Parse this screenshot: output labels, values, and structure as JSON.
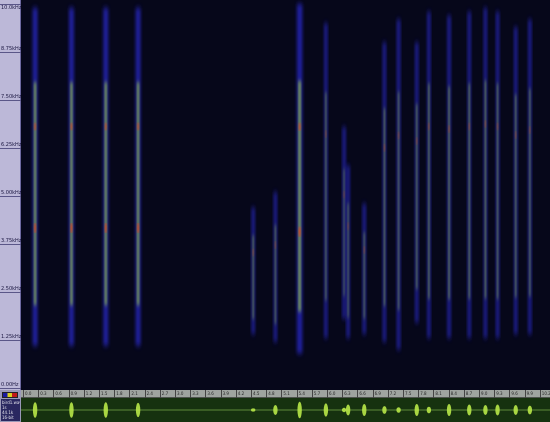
{
  "freq_ruler": {
    "labels": [
      "10.0kHz",
      "8.75kHz",
      "7.50kHz",
      "6.25kHz",
      "5.00kHz",
      "3.75kHz",
      "2.50kHz",
      "1.25kHz",
      "0.00Hz"
    ]
  },
  "time_ruler": {
    "labels": [
      "0.0",
      "0.3",
      "0.6",
      "0.9",
      "1.2",
      "1.5",
      "1.8",
      "2.1",
      "2.4",
      "2.7",
      "3.0",
      "3.3",
      "3.6",
      "3.9",
      "4.2",
      "4.5",
      "4.8",
      "5.1",
      "5.4",
      "5.7",
      "6.0",
      "6.3",
      "6.6",
      "6.9",
      "7.2",
      "7.5",
      "7.8",
      "8.1",
      "8.4",
      "8.7",
      "9.0",
      "9.3",
      "9.6",
      "9.9",
      "10.2"
    ]
  },
  "info_panel": {
    "filename": "bird1.wav",
    "lines": [
      "1s",
      "44.1k",
      "16-bit"
    ]
  },
  "colors": {
    "background": "#06071a",
    "low": "#2a2ad0",
    "mid": "#a8e030",
    "high": "#ff2a10",
    "waveform": "#b8e848"
  },
  "spectrogram": {
    "calls": [
      {
        "t": 0.25,
        "w": 0.009,
        "f_lo": 1.1,
        "f_hi": 9.9,
        "i": 0.85
      },
      {
        "t": 1.15,
        "w": 0.009,
        "f_lo": 1.1,
        "f_hi": 9.9,
        "i": 0.85
      },
      {
        "t": 2.0,
        "w": 0.009,
        "f_lo": 1.1,
        "f_hi": 9.9,
        "i": 0.85
      },
      {
        "t": 2.8,
        "w": 0.009,
        "f_lo": 1.1,
        "f_hi": 9.9,
        "i": 0.85
      },
      {
        "t": 5.65,
        "w": 0.004,
        "f_lo": 1.4,
        "f_hi": 4.7,
        "i": 0.6
      },
      {
        "t": 6.2,
        "w": 0.004,
        "f_lo": 1.2,
        "f_hi": 5.1,
        "i": 0.55
      },
      {
        "t": 6.8,
        "w": 0.01,
        "f_lo": 0.9,
        "f_hi": 10.0,
        "i": 0.9
      },
      {
        "t": 7.45,
        "w": 0.004,
        "f_lo": 1.3,
        "f_hi": 9.5,
        "i": 0.55
      },
      {
        "t": 7.9,
        "w": 0.004,
        "f_lo": 1.8,
        "f_hi": 6.8,
        "i": 0.45
      },
      {
        "t": 8.0,
        "w": 0.004,
        "f_lo": 1.3,
        "f_hi": 5.8,
        "i": 0.5
      },
      {
        "t": 8.4,
        "w": 0.004,
        "f_lo": 1.4,
        "f_hi": 4.8,
        "i": 0.55
      },
      {
        "t": 8.9,
        "w": 0.005,
        "f_lo": 1.2,
        "f_hi": 9.0,
        "i": 0.6
      },
      {
        "t": 9.25,
        "w": 0.006,
        "f_lo": 1.0,
        "f_hi": 9.6,
        "i": 0.55
      },
      {
        "t": 9.7,
        "w": 0.005,
        "f_lo": 1.7,
        "f_hi": 9.0,
        "i": 0.6
      },
      {
        "t": 10.0,
        "w": 0.005,
        "f_lo": 1.3,
        "f_hi": 9.8,
        "i": 0.65
      },
      {
        "t": 10.5,
        "w": 0.006,
        "f_lo": 1.3,
        "f_hi": 9.7,
        "i": 0.65
      },
      {
        "t": 11.0,
        "w": 0.005,
        "f_lo": 1.3,
        "f_hi": 9.8,
        "i": 0.65
      },
      {
        "t": 11.4,
        "w": 0.005,
        "f_lo": 1.3,
        "f_hi": 9.9,
        "i": 0.65
      },
      {
        "t": 11.7,
        "w": 0.005,
        "f_lo": 1.3,
        "f_hi": 9.8,
        "i": 0.6
      },
      {
        "t": 12.15,
        "w": 0.005,
        "f_lo": 1.4,
        "f_hi": 9.4,
        "i": 0.6
      },
      {
        "t": 12.5,
        "w": 0.005,
        "f_lo": 1.4,
        "f_hi": 9.6,
        "i": 0.6
      }
    ]
  },
  "overview": {
    "bursts": [
      {
        "t": 0.25,
        "a": 0.7
      },
      {
        "t": 1.15,
        "a": 0.7
      },
      {
        "t": 2.0,
        "a": 0.7
      },
      {
        "t": 2.8,
        "a": 0.65
      },
      {
        "t": 5.65,
        "a": 0.15
      },
      {
        "t": 6.2,
        "a": 0.45
      },
      {
        "t": 6.8,
        "a": 0.75
      },
      {
        "t": 7.45,
        "a": 0.6
      },
      {
        "t": 7.9,
        "a": 0.2
      },
      {
        "t": 8.0,
        "a": 0.5
      },
      {
        "t": 8.4,
        "a": 0.55
      },
      {
        "t": 8.9,
        "a": 0.35
      },
      {
        "t": 9.25,
        "a": 0.25
      },
      {
        "t": 9.7,
        "a": 0.55
      },
      {
        "t": 10.0,
        "a": 0.3
      },
      {
        "t": 10.5,
        "a": 0.55
      },
      {
        "t": 11.0,
        "a": 0.5
      },
      {
        "t": 11.4,
        "a": 0.45
      },
      {
        "t": 11.7,
        "a": 0.5
      },
      {
        "t": 12.15,
        "a": 0.45
      },
      {
        "t": 12.5,
        "a": 0.4
      }
    ]
  }
}
